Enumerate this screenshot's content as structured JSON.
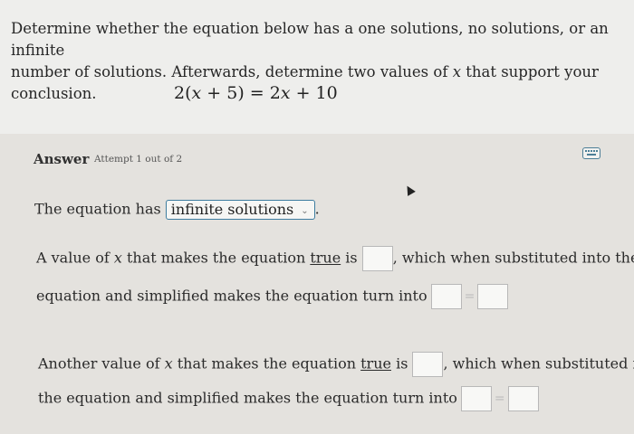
{
  "question": {
    "text_1": "Determine whether the equation below has a one solutions, no solutions, or an infinite",
    "text_2a": "number of solutions. Afterwards, determine two values of ",
    "text_2var": "x",
    "text_2b": " that support your conclusion."
  },
  "equation": {
    "lhs": "2(",
    "var1": "x",
    "lhs_rest": " + 5) = 2",
    "var2": "x",
    "rhs_rest": " + 10"
  },
  "answer": {
    "label": "Answer",
    "attempt": "Attempt 1 out of 2"
  },
  "line1": {
    "prefix": "The equation has ",
    "dropdown_value": "infinite solutions",
    "suffix": "."
  },
  "line2": {
    "a": "A value of ",
    "var": "x",
    "b": " that makes the equation ",
    "true_word": "true",
    "c": " is ",
    "d": ", which when substituted into the"
  },
  "line3": {
    "text": "equation and simplified makes the equation turn into"
  },
  "line4": {
    "a": "Another value of ",
    "var": "x",
    "b": " that makes the equation ",
    "true_word": "true",
    "c": " is ",
    "d": ", which when substituted into"
  },
  "line5": {
    "text": "the equation and simplified makes the equation turn into"
  },
  "equals": "="
}
